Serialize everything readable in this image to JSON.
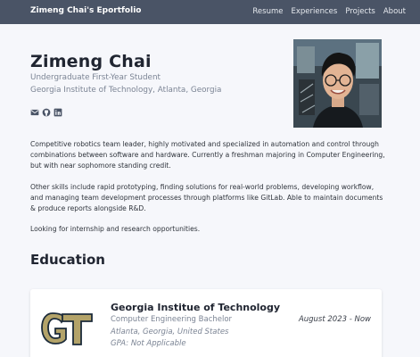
{
  "nav": {
    "brand": "Zimeng Chai's Eportfolio",
    "links": [
      "Resume",
      "Experiences",
      "Projects",
      "About"
    ]
  },
  "profile": {
    "name": "Zimeng Chai",
    "subtitle": "Undergraduate First-Year Student",
    "school": "Georgia Institute of Technology, Atlanta, Georgia",
    "icons": [
      "email-icon",
      "github-icon",
      "linkedin-icon"
    ]
  },
  "bio": [
    "Competitive robotics team leader, highly motivated and specialized in automation and control through combinations between software and hardware. Currently a freshman majoring in Computer Engineering, but with near sophomore standing credit.",
    "Other skills include rapid prototyping, finding solutions for real-world problems, developing workflow, and managing team development processes through platforms like GitLab. Able to maintain documents & produce reports alongside R&D.",
    "Looking for internship and research opportunities."
  ],
  "education": {
    "heading": "Education",
    "entries": [
      {
        "school": "Georgia Institue of Technology",
        "degree": "Computer Engineering Bachelor",
        "location": "Atlanta, Georgia, United States",
        "gpa": "GPA: Not Applicable",
        "date": "August 2023 - Now",
        "logo": "GT"
      }
    ]
  },
  "colors": {
    "navbar": "#4a5466",
    "background": "#f6f7fb",
    "muted": "#7b8494",
    "gt_gold": "#b3a369",
    "gt_navy": "#1c2b3a"
  }
}
